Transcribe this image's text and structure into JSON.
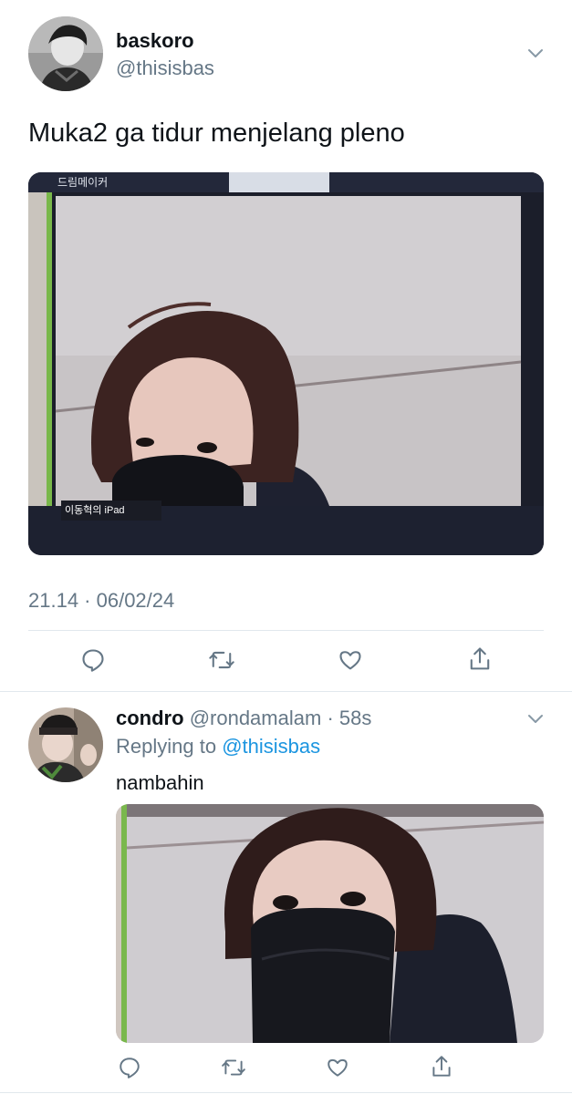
{
  "main_tweet": {
    "display_name": "baskoro",
    "handle": "@thisisbas",
    "text": "Muka2 ga tidur menjelang pleno",
    "media_label": "드림메이커",
    "media_caption": "이동혁의 iPad",
    "timestamp": "21.14 · 06/02/24",
    "actions": [
      "reply-icon",
      "retweet-icon",
      "like-icon",
      "share-icon"
    ]
  },
  "reply_tweet": {
    "display_name": "condro",
    "handle": "@rondamalam",
    "time": "· 58s",
    "replying_prefix": "Replying to",
    "replying_to": "@thisisbas",
    "text": "nambahin",
    "actions": [
      "reply-icon",
      "retweet-icon",
      "like-icon",
      "share-icon"
    ]
  },
  "colors": {
    "text": "#0f1419",
    "muted": "#657786",
    "link": "#1b95e0",
    "divider": "#e1e8ed"
  }
}
